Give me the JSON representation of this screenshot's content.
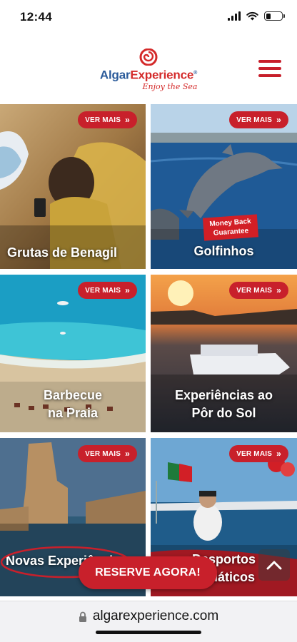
{
  "status_bar": {
    "time": "12:44",
    "icons": [
      "signal-icon",
      "wifi-icon",
      "battery-icon"
    ]
  },
  "header": {
    "logo_part1": "Algar",
    "logo_part2": "Experience",
    "logo_mark": "®",
    "tagline": "Enjoy the Sea",
    "menu_icon": "hamburger-menu-icon"
  },
  "tiles": [
    {
      "title": "Grutas de Benagil",
      "button": "VER MAIS",
      "button_icon": "double-chevron-right-icon"
    },
    {
      "title": "Golfinhos",
      "button": "VER MAIS",
      "button_icon": "double-chevron-right-icon",
      "badge_line1": "Money Back",
      "badge_line2": "Guarantee"
    },
    {
      "title_line1": "Barbecue",
      "title_line2": "na Praia",
      "button": "VER MAIS",
      "button_icon": "double-chevron-right-icon"
    },
    {
      "title_line1": "Experiências ao",
      "title_line2": "Pôr do Sol",
      "button": "VER MAIS",
      "button_icon": "double-chevron-right-icon"
    },
    {
      "title": "Novas Experiências",
      "button": "VER MAIS",
      "button_icon": "double-chevron-right-icon"
    },
    {
      "title_line1": "Desportos",
      "title_line2": "Aquáticos",
      "button": "VER MAIS",
      "button_icon": "double-chevron-right-icon"
    }
  ],
  "cta": {
    "reserve_label": "RESERVE AGORA!"
  },
  "scroll_top_icon": "chevron-up-icon",
  "browser": {
    "url": "algarexperience.com",
    "lock_icon": "lock-icon"
  },
  "colors": {
    "brand_red": "#c8202b",
    "brand_blue": "#2a5a9a"
  }
}
